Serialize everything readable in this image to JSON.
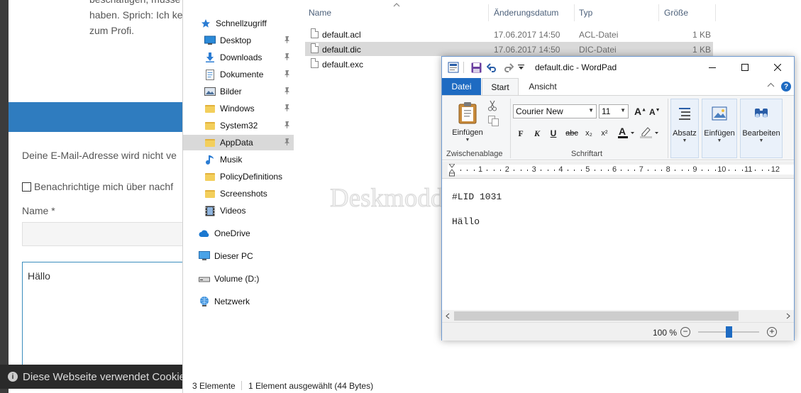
{
  "web_page": {
    "intro_lines": [
      "beschäftigen, müsse",
      "haben. Sprich: Ich ke",
      "zum Profi."
    ],
    "email_notice": "Deine E-Mail-Adresse wird nicht ve",
    "notify_checkbox_label": "Benachrichtige mich über nachf",
    "name_label": "Name *",
    "comment_text": "Hällo",
    "cookie_notice": "Diese Webseite verwendet Cookie",
    "accent_color": "#2f7cbf"
  },
  "explorer": {
    "nav": [
      {
        "label": "Schnellzugriff",
        "icon": "star-icon"
      },
      {
        "label": "Desktop",
        "icon": "desktop-icon",
        "pinned": true
      },
      {
        "label": "Downloads",
        "icon": "download-icon",
        "pinned": true
      },
      {
        "label": "Dokumente",
        "icon": "document-icon",
        "pinned": true
      },
      {
        "label": "Bilder",
        "icon": "pictures-icon",
        "pinned": true
      },
      {
        "label": "Windows",
        "icon": "folder-icon",
        "pinned": true
      },
      {
        "label": "System32",
        "icon": "folder-icon",
        "pinned": true
      },
      {
        "label": "AppData",
        "icon": "folder-icon",
        "pinned": true,
        "selected": true
      },
      {
        "label": "Musik",
        "icon": "music-icon"
      },
      {
        "label": "PolicyDefinitions",
        "icon": "folder-icon"
      },
      {
        "label": "Screenshots",
        "icon": "folder-icon"
      },
      {
        "label": "Videos",
        "icon": "videos-icon"
      },
      {
        "label": "OneDrive",
        "icon": "cloud-icon"
      },
      {
        "label": "Dieser PC",
        "icon": "pc-icon"
      },
      {
        "label": "Volume (D:)",
        "icon": "drive-icon"
      },
      {
        "label": "Netzwerk",
        "icon": "network-icon"
      }
    ],
    "columns": [
      "Name",
      "Änderungsdatum",
      "Typ",
      "Größe"
    ],
    "files": [
      {
        "name": "default.acl",
        "date": "17.06.2017 14:50",
        "type": "ACL-Datei",
        "size": "1 KB"
      },
      {
        "name": "default.dic",
        "date": "17.06.2017 14:50",
        "type": "DIC-Datei",
        "size": "1 KB",
        "selected": true
      },
      {
        "name": "default.exc",
        "date": "",
        "type": "",
        "size": ""
      }
    ],
    "status": {
      "count": "3 Elemente",
      "selection": "1 Element ausgewählt (44 Bytes)"
    }
  },
  "wordpad": {
    "title": "default.dic - WordPad",
    "tabs": {
      "file": "Datei",
      "start": "Start",
      "view": "Ansicht"
    },
    "ribbon": {
      "paste_label": "Einfügen",
      "clipboard_group": "Zwischenablage",
      "font_name": "Courier New",
      "font_size": "11",
      "font_group": "Schriftart",
      "paragraph_label": "Absatz",
      "insert_label": "Einfügen",
      "edit_label": "Bearbeiten",
      "bold": "F",
      "italic": "K",
      "underline": "U",
      "strike": "abc",
      "subscript": "x₂",
      "superscript": "x²"
    },
    "ruler_numbers": [
      "1",
      "2",
      "3",
      "4",
      "5",
      "6",
      "7",
      "8",
      "9",
      "10",
      "11",
      "12"
    ],
    "document_lines": [
      "#LID 1031",
      "Hällo"
    ],
    "zoom": "100 %",
    "zoom_level_percent": 100,
    "accent_color": "#1e6bc2"
  },
  "watermark": "Deskmodder.de"
}
